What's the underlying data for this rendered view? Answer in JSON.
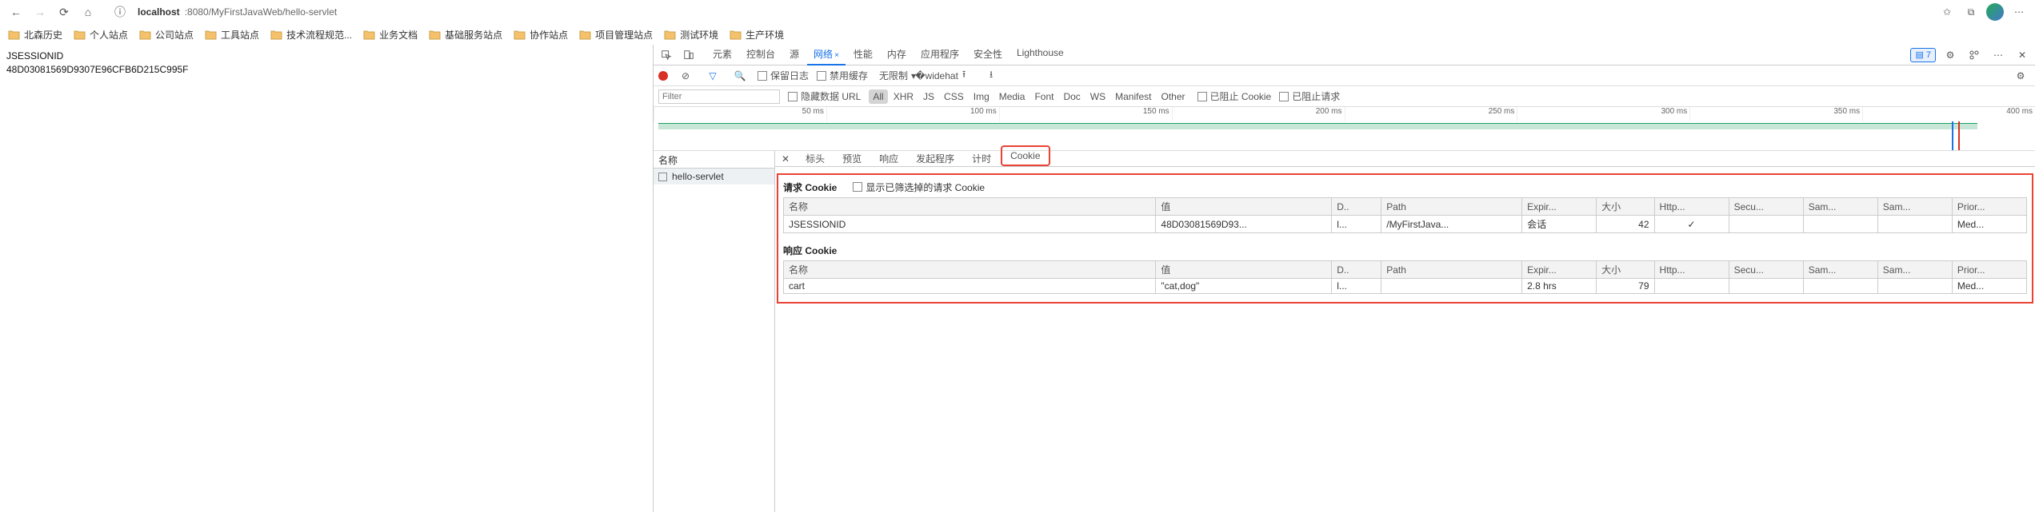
{
  "browser": {
    "url_host": "localhost",
    "url_port_path": ":8080/MyFirstJavaWeb/hello-servlet"
  },
  "bookmarks": [
    "北森历史",
    "个人站点",
    "公司站点",
    "工具站点",
    "技术流程规范...",
    "业务文档",
    "基础服务站点",
    "协作站点",
    "项目管理站点",
    "测试环境",
    "生产环境"
  ],
  "page": {
    "line1": "JSESSIONID",
    "line2": "48D03081569D9307E96CFB6D215C995F"
  },
  "devtools": {
    "tabs": [
      "元素",
      "控制台",
      "源",
      "网络",
      "性能",
      "内存",
      "应用程序",
      "安全性",
      "Lighthouse"
    ],
    "active_tab": 3,
    "msg_count": "7",
    "toolbar": {
      "preserve": "保留日志",
      "disable_cache": "禁用缓存",
      "throttle": "无限制"
    },
    "filter": {
      "placeholder": "Filter",
      "hide_data_urls": "隐藏数据 URL",
      "types": [
        "All",
        "XHR",
        "JS",
        "CSS",
        "Img",
        "Media",
        "Font",
        "Doc",
        "WS",
        "Manifest",
        "Other"
      ],
      "blocked_cookie": "已阻止 Cookie",
      "blocked_req": "已阻止请求"
    },
    "timeline_ticks": [
      "50 ms",
      "100 ms",
      "150 ms",
      "200 ms",
      "250 ms",
      "300 ms",
      "350 ms",
      "400 ms"
    ],
    "requests": {
      "header": "名称",
      "rows": [
        "hello-servlet"
      ]
    },
    "detail": {
      "tabs": [
        "标头",
        "预览",
        "响应",
        "发起程序",
        "计时",
        "Cookie"
      ],
      "req_cookie_title": "请求 Cookie",
      "show_filtered": "显示已筛选掉的请求 Cookie",
      "resp_cookie_title": "响应 Cookie",
      "cols": {
        "name": "名称",
        "value": "值",
        "d": "D..",
        "path": "Path",
        "expires": "Expir...",
        "size": "大小",
        "http": "Http...",
        "secure": "Secu...",
        "same": "Sam...",
        "same2": "Sam...",
        "prio": "Prior..."
      },
      "req_rows": [
        {
          "name": "JSESSIONID",
          "value": "48D03081569D93...",
          "d": "l...",
          "path": "/MyFirstJava...",
          "expires": "会话",
          "size": "42",
          "http": "✓",
          "secure": "",
          "same": "",
          "same2": "",
          "prio": "Med..."
        }
      ],
      "resp_rows": [
        {
          "name": "cart",
          "value": "\"cat,dog\"",
          "d": "l...",
          "path": "",
          "expires": "2.8 hrs",
          "size": "79",
          "http": "",
          "secure": "",
          "same": "",
          "same2": "",
          "prio": "Med..."
        }
      ]
    }
  }
}
